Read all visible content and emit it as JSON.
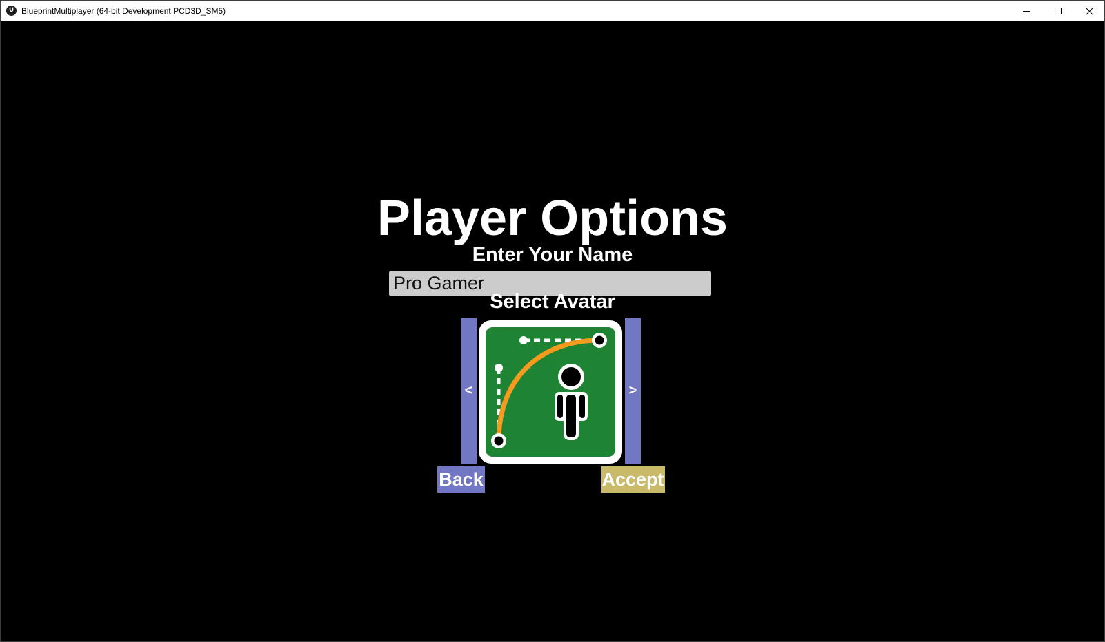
{
  "window": {
    "title": "BlueprintMultiplayer (64-bit Development PCD3D_SM5)",
    "app_icon_glyph": "U"
  },
  "menu": {
    "title": "Player Options",
    "name_label": "Enter Your Name",
    "name_value": "Pro Gamer",
    "avatar_label": "Select Avatar",
    "prev_label": "<",
    "next_label": ">",
    "back_label": "Back",
    "accept_label": "Accept",
    "avatar_icon": "player-path-avatar-icon"
  },
  "colors": {
    "arrow_button": "#7277c4",
    "back_button": "#7277c4",
    "accept_button": "#c8ba68",
    "avatar_background": "#1e8434",
    "avatar_path": "#f49a1e",
    "name_input_background": "#cccccc"
  }
}
